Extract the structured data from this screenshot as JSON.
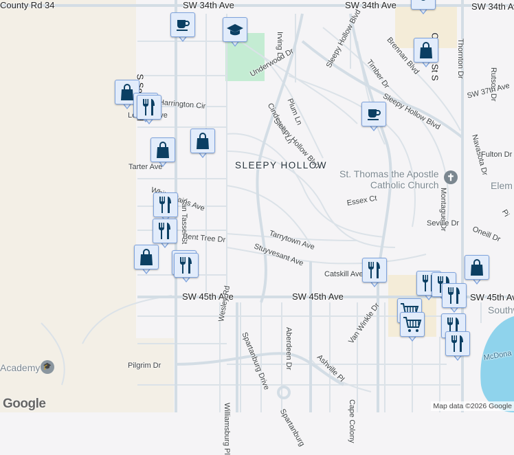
{
  "map": {
    "area_label": "SLEEPY HOLLOW",
    "streets": [
      "County Rd 34",
      "SW 34th Ave",
      "SW 34th Ave",
      "SW 34th Ave",
      "S Soncy Rd",
      "Irving Ln",
      "Sleepy Hollow Blvd",
      "Brennan Blvd",
      "Timber Dr",
      "Coulter St S",
      "Thornton Dr",
      "Rutson Dr",
      "Underwood Dr",
      "Cinderella Ln",
      "Plum Ln",
      "Harrington Cir",
      "Sleepy Hollow Blvd",
      "SW 37th Ave",
      "Navasota Dr",
      "Legend Ave",
      "Sleepy Hollow Blvd",
      "Fulton Dr",
      "Tarter Ave",
      "Montague Dr",
      "Van Tassel St",
      "White Plains Ave",
      "Essex Ct",
      "Seville Dr",
      "Oneill Dr",
      "Tarrytown Ave",
      "Bent Tree Dr",
      "Stuyvesant Ave",
      "Catskill Ave",
      "SW 45th Ave",
      "SW 45th Ave",
      "SW 45th Ave",
      "Wesley Rd",
      "Spartanburg Drive",
      "Aberdeen Dr",
      "Van Winkle Dr",
      "Ashville Pl",
      "Pilgrim Dr",
      "Williamsburg Pl",
      "Cape Colony",
      "Spartanburg",
      "Elem",
      "Pi",
      "Southw",
      "McDona"
    ],
    "pois": {
      "church": "St. Thomas the Apostle Catholic Church",
      "church_line1": "St. Thomas the Apostle",
      "church_line2": "Catholic Church",
      "academy": "Academy"
    },
    "markers": [
      {
        "type": "other"
      },
      {
        "type": "coffee"
      },
      {
        "type": "school"
      },
      {
        "type": "shopping"
      },
      {
        "type": "restaurant"
      },
      {
        "type": "restaurant"
      },
      {
        "type": "shopping"
      },
      {
        "type": "shopping"
      },
      {
        "type": "coffee"
      },
      {
        "type": "shopping"
      },
      {
        "type": "restaurant"
      },
      {
        "type": "restaurant"
      },
      {
        "type": "shopping"
      },
      {
        "type": "restaurant"
      },
      {
        "type": "restaurant"
      },
      {
        "type": "restaurant"
      },
      {
        "type": "restaurant"
      },
      {
        "type": "restaurant"
      },
      {
        "type": "shopping"
      },
      {
        "type": "grocery"
      },
      {
        "type": "grocery"
      },
      {
        "type": "restaurant"
      },
      {
        "type": "restaurant"
      },
      {
        "type": "restaurant"
      }
    ],
    "colors": {
      "marker_fill": "#e2ecfb",
      "marker_border": "#7ea3dd",
      "icon": "#0b3f63",
      "park": "#c4ecd3",
      "water": "#8fd3ec",
      "rural": "#f3efe6",
      "road": "#d3dde5"
    }
  },
  "footer": {
    "logo": "Google",
    "attribution": "Map data ©2026 Google"
  }
}
